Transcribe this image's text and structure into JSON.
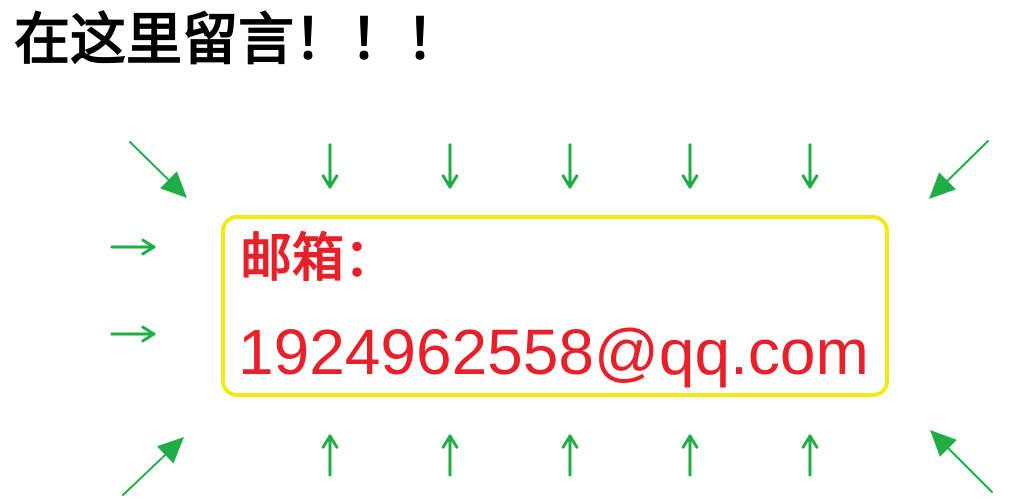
{
  "title": "在这里留言！！！",
  "contact": {
    "label": "邮箱：",
    "email": "1924962558@qq.com"
  },
  "colors": {
    "title": "#000000",
    "contact_text": "#e8202a",
    "box_border": "#f2ea12",
    "arrows": "#1fad46"
  },
  "arrow_icons": {
    "down": "arrow-down-icon",
    "up": "arrow-up-icon",
    "right": "arrow-right-icon",
    "diagonal": "diagonal-arrow-icon"
  }
}
